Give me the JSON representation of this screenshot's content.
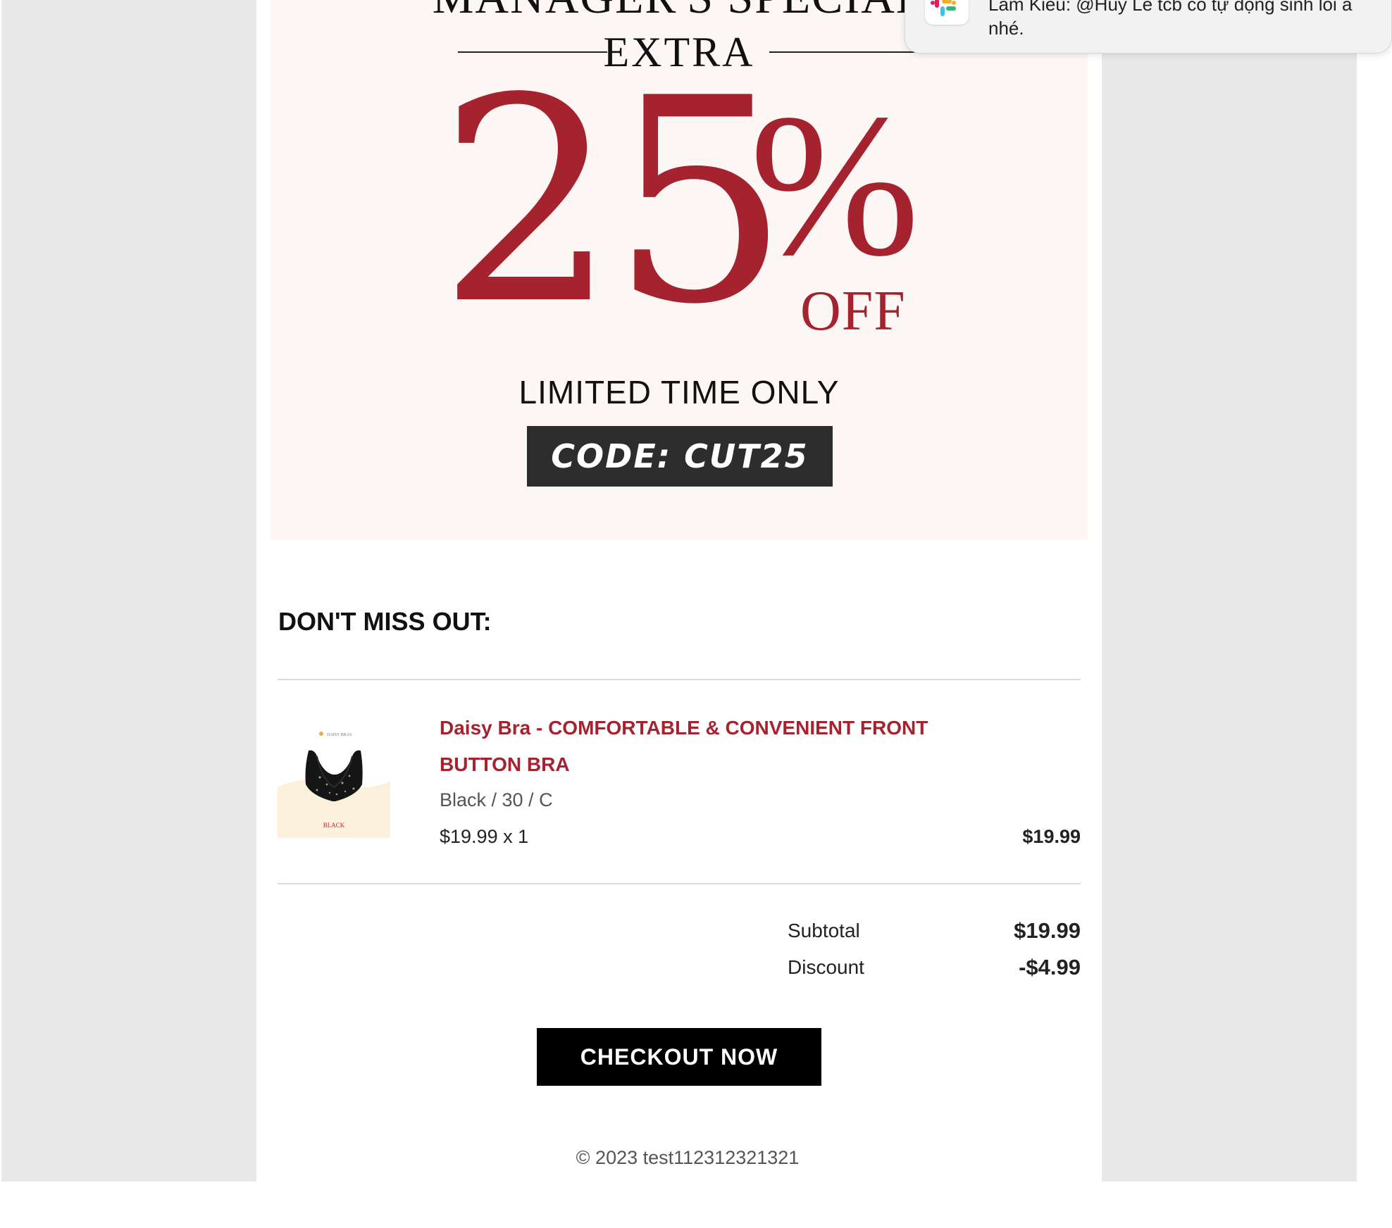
{
  "banner": {
    "title": "MANAGER'S SPECIAL",
    "extra": "EXTRA",
    "number": "25",
    "percent": "%",
    "off": "OFF",
    "limited": "LIMITED TIME ONLY",
    "code": "CODE: CUT25"
  },
  "section": {
    "heading": "DON'T MISS OUT:"
  },
  "product": {
    "thumb_brand": "DAISY BRAS",
    "thumb_color": "BLACK",
    "title": "Daisy Bra - COMFORTABLE & CONVENIENT FRONT BUTTON BRA",
    "variant": "Black / 30 / C",
    "qty_line": "$19.99 x 1",
    "line_price": "$19.99"
  },
  "summary": {
    "subtotal_label": "Subtotal",
    "subtotal_value": "$19.99",
    "discount_label": "Discount",
    "discount_value": "-$4.99"
  },
  "checkout": {
    "label": "CHECKOUT NOW"
  },
  "footer": {
    "text": "© 2023 test112312321321"
  },
  "notification": {
    "app_icon": "slack-icon",
    "text": "Lam Kieu: @Huy Le tcb có tự động sinh lỗi a nhé."
  },
  "colors": {
    "accent": "#a5222f",
    "banner_bg": "#fcf7f5",
    "outer_bg": "#e8e8e8",
    "code_bg": "#2d2d2d",
    "button_bg": "#000000"
  }
}
